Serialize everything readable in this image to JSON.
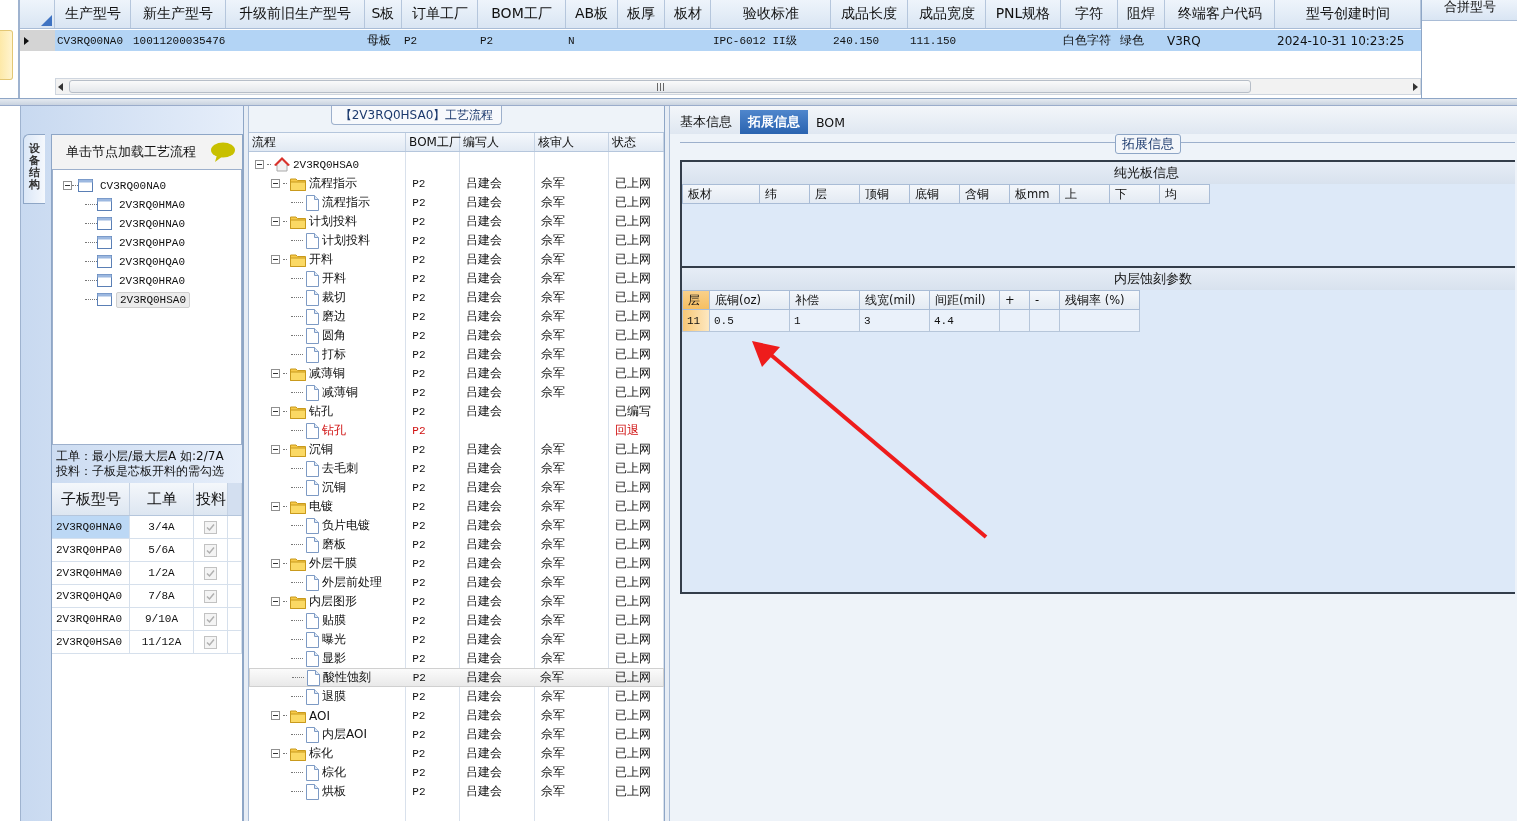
{
  "top_grid": {
    "columns": [
      "生产型号",
      "新生产型号",
      "升级前旧生产型号",
      "S板",
      "订单工厂",
      "BOM工厂",
      "AB板",
      "板厚",
      "板材",
      "验收标准",
      "成品长度",
      "成品宽度",
      "PNL规格",
      "字符",
      "阻焊",
      "终端客户代码",
      "型号创建时间"
    ],
    "rows": [
      {
        "selected": true,
        "cells": [
          "CV3RQ00NA0",
          "10011200035476",
          null,
          "母板",
          "P2",
          "P2",
          "N",
          null,
          null,
          "IPC-6012 II级",
          "240.150",
          "111.150",
          null,
          "白色字符",
          "绿色",
          "V3RQ",
          "2024-10-31 10:23:25"
        ]
      }
    ]
  },
  "side_panel": {
    "title": "合拼型号"
  },
  "structure": {
    "tab": "设备结构",
    "hint": "单击节点加载工艺流程",
    "tree": [
      {
        "label": "CV3RQ00NA0",
        "selected": false,
        "expanded": true,
        "children": [
          {
            "label": "2V3RQ0HMA0",
            "selected": false
          },
          {
            "label": "2V3RQ0HNA0",
            "selected": false
          },
          {
            "label": "2V3RQ0HPA0",
            "selected": false
          },
          {
            "label": "2V3RQ0HQA0",
            "selected": false
          },
          {
            "label": "2V3RQ0HRA0",
            "selected": false
          },
          {
            "label": "2V3RQ0HSA0",
            "selected": true
          }
        ]
      }
    ],
    "notes": [
      "工单：最小层/最大层A 如:2/7A",
      "投料：子板是芯板开料的需勾选"
    ],
    "table": {
      "columns": [
        "子板型号",
        "工单",
        "投料"
      ],
      "rows": [
        {
          "model": "2V3RQ0HNA0",
          "order": "3/4A",
          "checked": true,
          "disabled": true,
          "selected": true
        },
        {
          "model": "2V3RQ0HPA0",
          "order": "5/6A",
          "checked": true,
          "disabled": true,
          "selected": false
        },
        {
          "model": "2V3RQ0HMA0",
          "order": "1/2A",
          "checked": true,
          "disabled": true,
          "selected": false
        },
        {
          "model": "2V3RQ0HQA0",
          "order": "7/8A",
          "checked": true,
          "disabled": true,
          "selected": false
        },
        {
          "model": "2V3RQ0HRA0",
          "order": "9/10A",
          "checked": true,
          "disabled": true,
          "selected": false
        },
        {
          "model": "2V3RQ0HSA0",
          "order": "11/12A",
          "checked": true,
          "disabled": true,
          "selected": false
        }
      ]
    }
  },
  "process": {
    "title": "【2V3RQ0HSA0】工艺流程",
    "columns": [
      "流程",
      "BOM工厂",
      "编写人",
      "核审人",
      "状态"
    ],
    "tree": [
      {
        "name": "2V3RQ0HSA0",
        "kind": "root",
        "expanded": true,
        "selected": false,
        "returned": false,
        "children": [
          {
            "name": "流程指示",
            "kind": "group",
            "bom": "P2",
            "writer": "吕建会",
            "reviewer": "佘军",
            "status": "已上网",
            "expanded": true,
            "selected": false,
            "returned": false,
            "children": [
              {
                "name": "流程指示",
                "kind": "step",
                "bom": "P2",
                "writer": "吕建会",
                "reviewer": "佘军",
                "status": "已上网",
                "selected": false,
                "returned": false
              }
            ]
          },
          {
            "name": "计划投料",
            "kind": "group",
            "bom": "P2",
            "writer": "吕建会",
            "reviewer": "佘军",
            "status": "已上网",
            "expanded": true,
            "selected": false,
            "returned": false,
            "children": [
              {
                "name": "计划投料",
                "kind": "step",
                "bom": "P2",
                "writer": "吕建会",
                "reviewer": "佘军",
                "status": "已上网",
                "selected": false,
                "returned": false
              }
            ]
          },
          {
            "name": "开料",
            "kind": "group",
            "bom": "P2",
            "writer": "吕建会",
            "reviewer": "佘军",
            "status": "已上网",
            "expanded": true,
            "selected": false,
            "returned": false,
            "children": [
              {
                "name": "开料",
                "kind": "step",
                "bom": "P2",
                "writer": "吕建会",
                "reviewer": "佘军",
                "status": "已上网",
                "selected": false,
                "returned": false
              },
              {
                "name": "裁切",
                "kind": "step",
                "bom": "P2",
                "writer": "吕建会",
                "reviewer": "佘军",
                "status": "已上网",
                "selected": false,
                "returned": false
              },
              {
                "name": "磨边",
                "kind": "step",
                "bom": "P2",
                "writer": "吕建会",
                "reviewer": "佘军",
                "status": "已上网",
                "selected": false,
                "returned": false
              },
              {
                "name": "圆角",
                "kind": "step",
                "bom": "P2",
                "writer": "吕建会",
                "reviewer": "佘军",
                "status": "已上网",
                "selected": false,
                "returned": false
              },
              {
                "name": "打标",
                "kind": "step",
                "bom": "P2",
                "writer": "吕建会",
                "reviewer": "佘军",
                "status": "已上网",
                "selected": false,
                "returned": false
              }
            ]
          },
          {
            "name": "减薄铜",
            "kind": "group",
            "bom": "P2",
            "writer": "吕建会",
            "reviewer": "佘军",
            "status": "已上网",
            "expanded": true,
            "selected": false,
            "returned": false,
            "children": [
              {
                "name": "减薄铜",
                "kind": "step",
                "bom": "P2",
                "writer": "吕建会",
                "reviewer": "佘军",
                "status": "已上网",
                "selected": false,
                "returned": false
              }
            ]
          },
          {
            "name": "钻孔",
            "kind": "group",
            "bom": "P2",
            "writer": "吕建会",
            "status": "已编写",
            "expanded": true,
            "selected": false,
            "returned": false,
            "children": [
              {
                "name": "钻孔",
                "kind": "step",
                "bom": "P2",
                "status": "回退",
                "selected": false,
                "returned": true
              }
            ]
          },
          {
            "name": "沉铜",
            "kind": "group",
            "bom": "P2",
            "writer": "吕建会",
            "reviewer": "佘军",
            "status": "已上网",
            "expanded": true,
            "selected": false,
            "returned": false,
            "children": [
              {
                "name": "去毛刺",
                "kind": "step",
                "bom": "P2",
                "writer": "吕建会",
                "reviewer": "佘军",
                "status": "已上网",
                "selected": false,
                "returned": false
              },
              {
                "name": "沉铜",
                "kind": "step",
                "bom": "P2",
                "writer": "吕建会",
                "reviewer": "佘军",
                "status": "已上网",
                "selected": false,
                "returned": false
              }
            ]
          },
          {
            "name": "电镀",
            "kind": "group",
            "bom": "P2",
            "writer": "吕建会",
            "reviewer": "佘军",
            "status": "已上网",
            "expanded": true,
            "selected": false,
            "returned": false,
            "children": [
              {
                "name": "负片电镀",
                "kind": "step",
                "bom": "P2",
                "writer": "吕建会",
                "reviewer": "佘军",
                "status": "已上网",
                "selected": false,
                "returned": false
              },
              {
                "name": "磨板",
                "kind": "step",
                "bom": "P2",
                "writer": "吕建会",
                "reviewer": "佘军",
                "status": "已上网",
                "selected": false,
                "returned": false
              }
            ]
          },
          {
            "name": "外层干膜",
            "kind": "group",
            "bom": "P2",
            "writer": "吕建会",
            "reviewer": "佘军",
            "status": "已上网",
            "expanded": true,
            "selected": false,
            "returned": false,
            "children": [
              {
                "name": "外层前处理",
                "kind": "step",
                "bom": "P2",
                "writer": "吕建会",
                "reviewer": "佘军",
                "status": "已上网",
                "selected": false,
                "returned": false
              }
            ]
          },
          {
            "name": "内层图形",
            "kind": "group",
            "bom": "P2",
            "writer": "吕建会",
            "reviewer": "佘军",
            "status": "已上网",
            "expanded": true,
            "selected": false,
            "returned": false,
            "children": [
              {
                "name": "贴膜",
                "kind": "step",
                "bom": "P2",
                "writer": "吕建会",
                "reviewer": "佘军",
                "status": "已上网",
                "selected": false,
                "returned": false
              },
              {
                "name": "曝光",
                "kind": "step",
                "bom": "P2",
                "writer": "吕建会",
                "reviewer": "佘军",
                "status": "已上网",
                "selected": false,
                "returned": false
              },
              {
                "name": "显影",
                "kind": "step",
                "bom": "P2",
                "writer": "吕建会",
                "reviewer": "佘军",
                "status": "已上网",
                "selected": false,
                "returned": false
              },
              {
                "name": "酸性蚀刻",
                "kind": "step",
                "bom": "P2",
                "writer": "吕建会",
                "reviewer": "佘军",
                "status": "已上网",
                "selected": true,
                "returned": false
              },
              {
                "name": "退膜",
                "kind": "step",
                "bom": "P2",
                "writer": "吕建会",
                "reviewer": "佘军",
                "status": "已上网",
                "selected": false,
                "returned": false
              }
            ]
          },
          {
            "name": "AOI",
            "kind": "group",
            "bom": "P2",
            "writer": "吕建会",
            "reviewer": "佘军",
            "status": "已上网",
            "expanded": true,
            "selected": false,
            "returned": false,
            "children": [
              {
                "name": "内层AOI",
                "kind": "step",
                "bom": "P2",
                "writer": "吕建会",
                "reviewer": "佘军",
                "status": "已上网",
                "selected": false,
                "returned": false
              }
            ]
          },
          {
            "name": "棕化",
            "kind": "group",
            "bom": "P2",
            "writer": "吕建会",
            "reviewer": "佘军",
            "status": "已上网",
            "expanded": true,
            "selected": false,
            "returned": false,
            "children": [
              {
                "name": "棕化",
                "kind": "step",
                "bom": "P2",
                "writer": "吕建会",
                "reviewer": "佘军",
                "status": "已上网",
                "selected": false,
                "returned": false
              },
              {
                "name": "烘板",
                "kind": "step",
                "bom": "P2",
                "writer": "吕建会",
                "reviewer": "佘军",
                "status": "已上网",
                "selected": false,
                "returned": false
              }
            ]
          }
        ]
      }
    ]
  },
  "details": {
    "tabs": [
      {
        "label": "基本信息",
        "selected": false
      },
      {
        "label": "拓展信息",
        "selected": true
      },
      {
        "label": "BOM",
        "selected": false
      }
    ],
    "group_title": "拓展信息",
    "bare_board": {
      "title": "纯光板信息",
      "columns": [
        "板材",
        "纬",
        "层",
        "顶铜",
        "底铜",
        "含铜",
        "板mm",
        "上",
        "下",
        "均"
      ]
    },
    "inner_etch": {
      "title": "内层蚀刻参数",
      "columns": [
        "层",
        "底铜(oz)",
        "补偿",
        "线宽(mil)",
        "间距(mil)",
        "+",
        "-",
        "残铜率 (%)"
      ],
      "rows": [
        {
          "selected": true,
          "cells": [
            "11",
            "0.5",
            "1",
            "3",
            "4.4",
            null,
            null,
            null
          ]
        }
      ]
    }
  }
}
